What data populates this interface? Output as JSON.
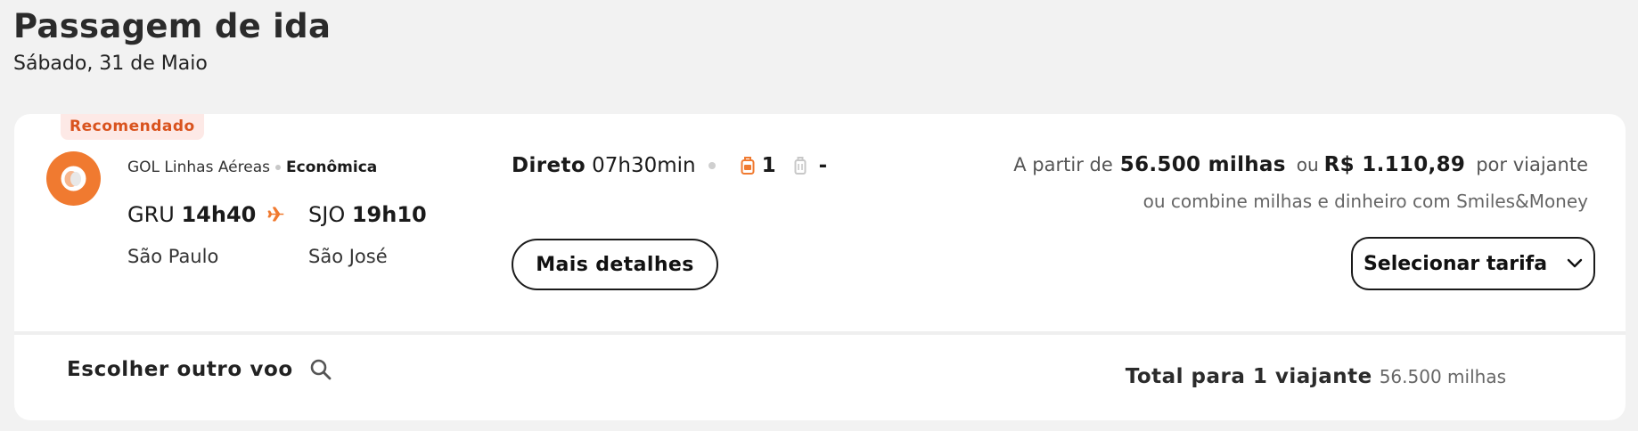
{
  "header": {
    "title": "Passagem de ida",
    "date": "Sábado, 31 de Maio"
  },
  "flight_card": {
    "badge": "Recomendado",
    "airline": "GOL Linhas Aéreas",
    "fare_class": "Econômica",
    "logo_icon": "gol-logo-icon",
    "origin_code": "GRU",
    "departure_time": "14h40",
    "destination_code": "SJO",
    "arrival_time": "19h10",
    "origin_city": "São Paulo",
    "destination_city": "São José",
    "stops": "Direto",
    "duration": "07h30min",
    "carry_on_count": "1",
    "checked_bag_count": "-",
    "details_button": "Mais detalhes",
    "price_prefix": "A partir de",
    "price_miles": "56.500 milhas",
    "price_or": "ou",
    "price_money": "R$ 1.110,89",
    "price_suffix": "por viajante",
    "combine_text": "ou combine milhas e dinheiro com Smiles&Money",
    "select_fare_button": "Selecionar tarifa"
  },
  "footer": {
    "other_flight": "Escolher outro voo",
    "total_label": "Total para 1 viajante",
    "total_value": "56.500 milhas"
  },
  "colors": {
    "accent": "#f07a30",
    "badge_text": "#d9531e",
    "badge_bg": "#fde9e6",
    "background": "#f2f2f2"
  }
}
